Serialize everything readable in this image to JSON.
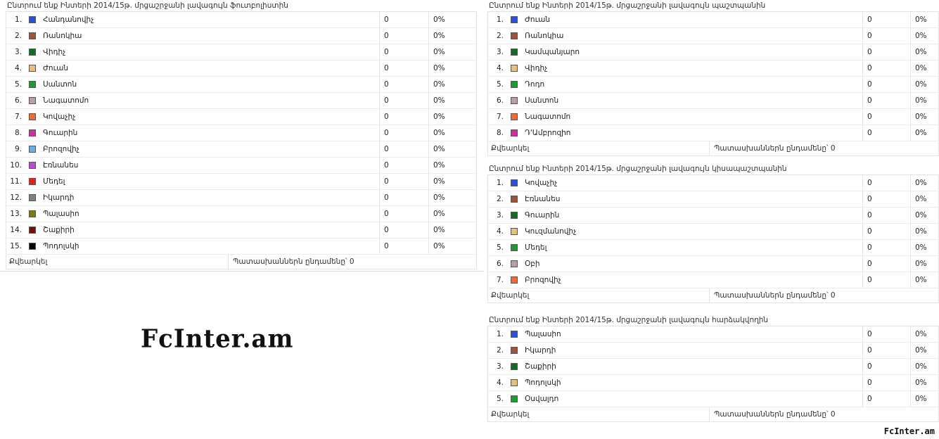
{
  "polls": [
    {
      "title": "Ընտրում ենք Ինտերի 2014/15թ. մրցաշրջանի լավագույն ֆուտբոլիստին",
      "rows": [
        {
          "n": "1.",
          "name": "Հանդանովիչ",
          "count": "0",
          "pct": "0%",
          "color": "#2b4fd6"
        },
        {
          "n": "2.",
          "name": "Ռանոկիա",
          "count": "0",
          "pct": "0%",
          "color": "#a0523a"
        },
        {
          "n": "3.",
          "name": "Վիդիչ",
          "count": "0",
          "pct": "0%",
          "color": "#136b26"
        },
        {
          "n": "4.",
          "name": "Ժուան",
          "count": "0",
          "pct": "0%",
          "color": "#e3c279"
        },
        {
          "n": "5.",
          "name": "Սանտոն",
          "count": "0",
          "pct": "0%",
          "color": "#1f9c2f"
        },
        {
          "n": "6.",
          "name": "Նագատոմո",
          "count": "0",
          "pct": "0%",
          "color": "#b7a0a8"
        },
        {
          "n": "7.",
          "name": "Կովաչիչ",
          "count": "0",
          "pct": "0%",
          "color": "#f06a34"
        },
        {
          "n": "8.",
          "name": "Գուարին",
          "count": "0",
          "pct": "0%",
          "color": "#d42e9c"
        },
        {
          "n": "9.",
          "name": "Բրոզովիչ",
          "count": "0",
          "pct": "0%",
          "color": "#6aaee3"
        },
        {
          "n": "10.",
          "name": "Էռնանես",
          "count": "0",
          "pct": "0%",
          "color": "#c04ad8"
        },
        {
          "n": "11.",
          "name": "Մեդել",
          "count": "0",
          "pct": "0%",
          "color": "#f01c16"
        },
        {
          "n": "12.",
          "name": "Իկարդի",
          "count": "0",
          "pct": "0%",
          "color": "#808080"
        },
        {
          "n": "13.",
          "name": "Պալասիո",
          "count": "0",
          "pct": "0%",
          "color": "#7c7c0e"
        },
        {
          "n": "14.",
          "name": "Շաքիրի",
          "count": "0",
          "pct": "0%",
          "color": "#7a0d0d"
        },
        {
          "n": "15.",
          "name": "Պոդոլսկի",
          "count": "0",
          "pct": "0%",
          "color": "#050505"
        }
      ],
      "vote": "Քվեարկել",
      "total": "Պատասխաններն ընդամենը՝ 0"
    },
    {
      "title": "Ընտրում ենք Ինտերի 2014/15թ. մրցաշրջանի լավագույն պաշտպանին",
      "rows": [
        {
          "n": "1.",
          "name": "Ժուան",
          "count": "0",
          "pct": "0%",
          "color": "#2b4fd6"
        },
        {
          "n": "2.",
          "name": "Ռանոկիա",
          "count": "0",
          "pct": "0%",
          "color": "#a0523a"
        },
        {
          "n": "3.",
          "name": "Կամպանյարո",
          "count": "0",
          "pct": "0%",
          "color": "#136b26"
        },
        {
          "n": "4.",
          "name": "Վիդիչ",
          "count": "0",
          "pct": "0%",
          "color": "#e3c279"
        },
        {
          "n": "5.",
          "name": "Դոդո",
          "count": "0",
          "pct": "0%",
          "color": "#1f9c2f"
        },
        {
          "n": "6.",
          "name": "Սանտոն",
          "count": "0",
          "pct": "0%",
          "color": "#b7a0a8"
        },
        {
          "n": "7.",
          "name": "Նագատոմո",
          "count": "0",
          "pct": "0%",
          "color": "#f06a34"
        },
        {
          "n": "8.",
          "name": "Դ'Ամբրոզիո",
          "count": "0",
          "pct": "0%",
          "color": "#d42e9c"
        }
      ],
      "vote": "Քվեարկել",
      "total": "Պատասխաններն ընդամենը՝ 0"
    },
    {
      "title": "Ընտրում ենք Ինտերի 2014/15թ. մրցաշրջանի լավագույն կիսապաշտպանին",
      "rows": [
        {
          "n": "1.",
          "name": "Կովաչիչ",
          "count": "0",
          "pct": "0%",
          "color": "#2b4fd6"
        },
        {
          "n": "2.",
          "name": "Էռնանես",
          "count": "0",
          "pct": "0%",
          "color": "#a0523a"
        },
        {
          "n": "3.",
          "name": "Գուարին",
          "count": "0",
          "pct": "0%",
          "color": "#136b26"
        },
        {
          "n": "4.",
          "name": "Կուզմանովիչ",
          "count": "0",
          "pct": "0%",
          "color": "#e3c279"
        },
        {
          "n": "5.",
          "name": "Մեդել",
          "count": "0",
          "pct": "0%",
          "color": "#1f9c2f"
        },
        {
          "n": "6.",
          "name": "Օբի",
          "count": "0",
          "pct": "0%",
          "color": "#b7a0a8"
        },
        {
          "n": "7.",
          "name": "Բրոզովիչ",
          "count": "0",
          "pct": "0%",
          "color": "#f06a34"
        }
      ],
      "vote": "Քվեարկել",
      "total": "Պատասխաններն ընդամենը՝ 0"
    },
    {
      "title": "Ընտրում ենք Ինտերի 2014/15թ. մրցաշրջանի լավագույն հարձակվողին",
      "rows": [
        {
          "n": "1.",
          "name": "Պալասիո",
          "count": "0",
          "pct": "0%",
          "color": "#2b4fd6"
        },
        {
          "n": "2.",
          "name": "Իկարդի",
          "count": "0",
          "pct": "0%",
          "color": "#a0523a"
        },
        {
          "n": "3.",
          "name": "Շաքիրի",
          "count": "0",
          "pct": "0%",
          "color": "#136b26"
        },
        {
          "n": "4.",
          "name": "Պոդոլսկի",
          "count": "0",
          "pct": "0%",
          "color": "#e3c279"
        },
        {
          "n": "5.",
          "name": "Օսվալդո",
          "count": "0",
          "pct": "0%",
          "color": "#1f9c2f"
        }
      ],
      "vote": "Քվեարկել",
      "total": "Պատասխաններն ընդամենը՝ 0"
    }
  ],
  "logo_text": "FcInter.am",
  "watermark": "FcInter.am"
}
